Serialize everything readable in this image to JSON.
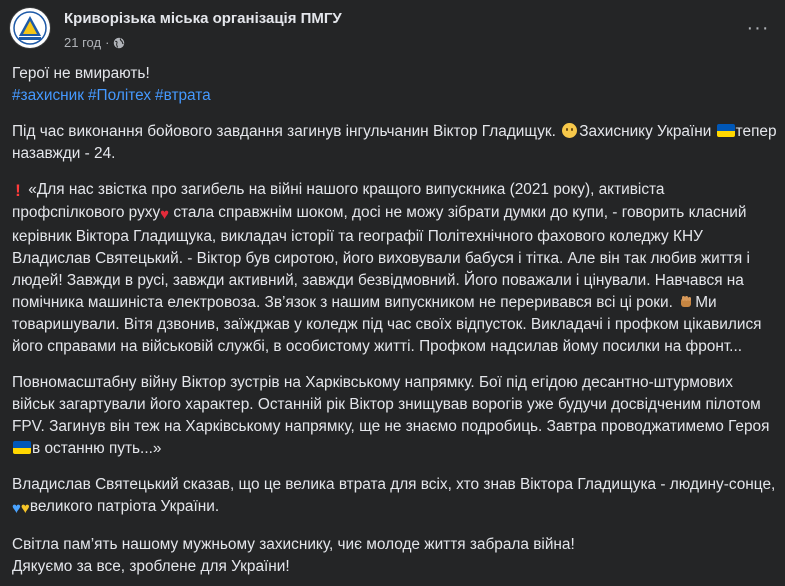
{
  "post": {
    "page_name": "Криворізька міська організація ПМГУ",
    "time": "21 год",
    "separator": "·",
    "more_label": "···",
    "title_line": "Герої не вмирають!",
    "hashtags": [
      "#захисник",
      "#Політех",
      "#втрата"
    ],
    "para1": {
      "part1": "Під час виконання бойового завдання загинув інгульчанин Віктор Гладищук.",
      "part2": "Захиснику України",
      "part3": "тепер назавжди - 24."
    },
    "quote1": {
      "part1": "«Для нас звістка про загибель на війні нашого кращого випускника (2021 року), активіста профспілкового руху",
      "part2": "стала справжнім шоком, досі не можу зібрати думки до купи, - говорить класний керівник Віктора Гладищука, викладач історії та географії Політехнічного фахового коледжу КНУ Владислав Святецький. - Віктор був сиротою, його виховували бабуся і тітка. Але він так любив життя і людей! Завжди в русі, завжди активний, завжди безвідмовний. Його поважали і цінували. Навчався на помічника машиніста електровоза. Зв’язок з нашим випускником не переривався всі ці роки.",
      "part3": "Ми товаришували. Вітя дзвонив, заїжджав у коледж під час своїх відпусток. Викладачі і профком цікавилися його справами на військовій службі, в особистому житті. Профком надсилав йому посилки на фронт..."
    },
    "quote2": {
      "part1": "Повномасштабну війну Віктор зустрів на Харківському напрямку. Бої під егідою десантно-штурмових військ загартували його характер. Останній рік Віктор знищував ворогів уже будучи досвідченим пілотом FPV. Загинув він теж на Харківському напрямку, ще не знаємо подробиць. Завтра проводжатимемо Героя",
      "part2": "в останню путь...»"
    },
    "para3": {
      "part1": "Владислав Святецький сказав, що це велика втрата для всіх, хто знав Віктора Гладищука - людину-сонце,",
      "part2": "великого патріота України."
    },
    "closing1": "Світла пам’ять нашому мужньому захиснику, чиє молоде життя забрала війна!",
    "closing2": "Дякуємо за все, зроблене для України!"
  },
  "colors": {
    "background": "#242526",
    "text": "#e4e6eb",
    "secondary_text": "#b0b3b8",
    "hashtag": "#4599ff",
    "flag_blue": "#0057b7",
    "flag_yellow": "#ffd700"
  },
  "icons": {
    "globe": "globe-icon",
    "more": "more-options-icon",
    "face": "sad-face-emoji",
    "flag": "ukraine-flag-emoji",
    "exclaim": "red-exclamation-emoji",
    "heart": "red-heart-emoji",
    "hand": "fist-emoji",
    "blue_heart": "blue-heart-emoji",
    "yellow_heart": "yellow-heart-emoji"
  }
}
